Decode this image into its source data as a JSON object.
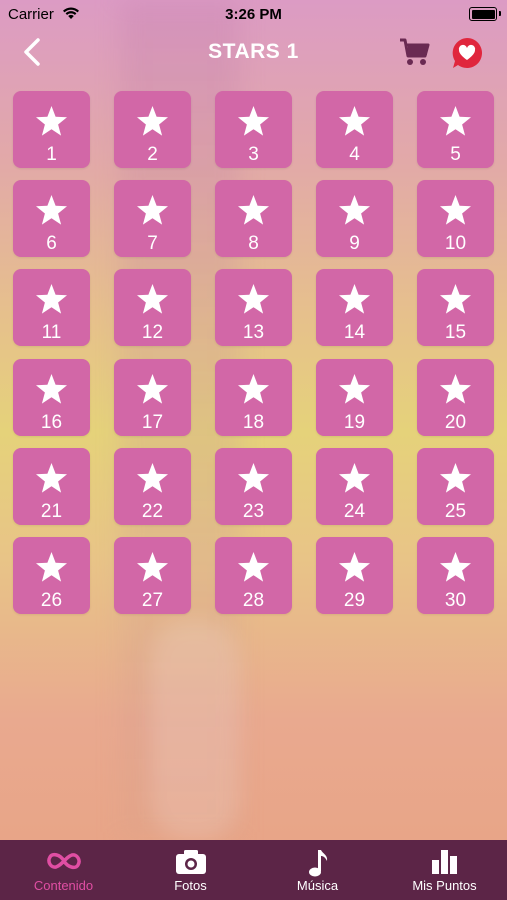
{
  "status_bar": {
    "carrier": "Carrier",
    "time": "3:26 PM"
  },
  "header": {
    "title": "STARS 1",
    "back_icon": "chevron-left-icon",
    "cart_icon": "cart-icon",
    "favorite_icon": "heart-badge-icon"
  },
  "colors": {
    "tile": "#d267a7",
    "tabbar": "#5c2547",
    "active_tab": "#e04ea3"
  },
  "stars": [
    {
      "label": "1"
    },
    {
      "label": "2"
    },
    {
      "label": "3"
    },
    {
      "label": "4"
    },
    {
      "label": "5"
    },
    {
      "label": "6"
    },
    {
      "label": "7"
    },
    {
      "label": "8"
    },
    {
      "label": "9"
    },
    {
      "label": "10"
    },
    {
      "label": "11"
    },
    {
      "label": "12"
    },
    {
      "label": "13"
    },
    {
      "label": "14"
    },
    {
      "label": "15"
    },
    {
      "label": "16"
    },
    {
      "label": "17"
    },
    {
      "label": "18"
    },
    {
      "label": "19"
    },
    {
      "label": "20"
    },
    {
      "label": "21"
    },
    {
      "label": "22"
    },
    {
      "label": "23"
    },
    {
      "label": "24"
    },
    {
      "label": "25"
    },
    {
      "label": "26"
    },
    {
      "label": "27"
    },
    {
      "label": "28"
    },
    {
      "label": "29"
    },
    {
      "label": "30"
    }
  ],
  "tabs": [
    {
      "label": "Contenido",
      "icon": "infinity-icon",
      "active": true
    },
    {
      "label": "Fotos",
      "icon": "camera-icon",
      "active": false
    },
    {
      "label": "Música",
      "icon": "music-note-icon",
      "active": false
    },
    {
      "label": "Mis Puntos",
      "icon": "bar-chart-icon",
      "active": false
    }
  ]
}
